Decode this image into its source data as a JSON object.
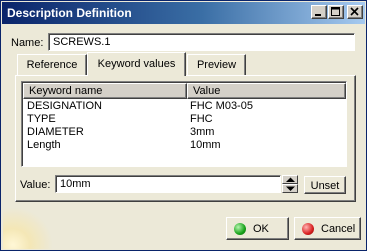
{
  "window": {
    "title": "Description Definition"
  },
  "name": {
    "label": "Name:",
    "value": "SCREWS.1"
  },
  "tabs": [
    {
      "label": "Reference",
      "active": false
    },
    {
      "label": "Keyword values",
      "active": true
    },
    {
      "label": "Preview",
      "active": false
    }
  ],
  "table": {
    "columns": [
      "Keyword name",
      "Value"
    ],
    "rows": [
      {
        "keyword": "DESIGNATION",
        "value": "FHC M03-05"
      },
      {
        "keyword": "TYPE",
        "value": "FHC"
      },
      {
        "keyword": "DIAMETER",
        "value": "3mm"
      },
      {
        "keyword": "Length",
        "value": "10mm"
      }
    ]
  },
  "value_field": {
    "label": "Value:",
    "value": "10mm"
  },
  "buttons": {
    "unset": "Unset",
    "ok": "OK",
    "cancel": "Cancel"
  },
  "colors": {
    "ok_icon": "#17a31a",
    "cancel_icon": "#d82020",
    "title_bar": "#0a246a"
  }
}
